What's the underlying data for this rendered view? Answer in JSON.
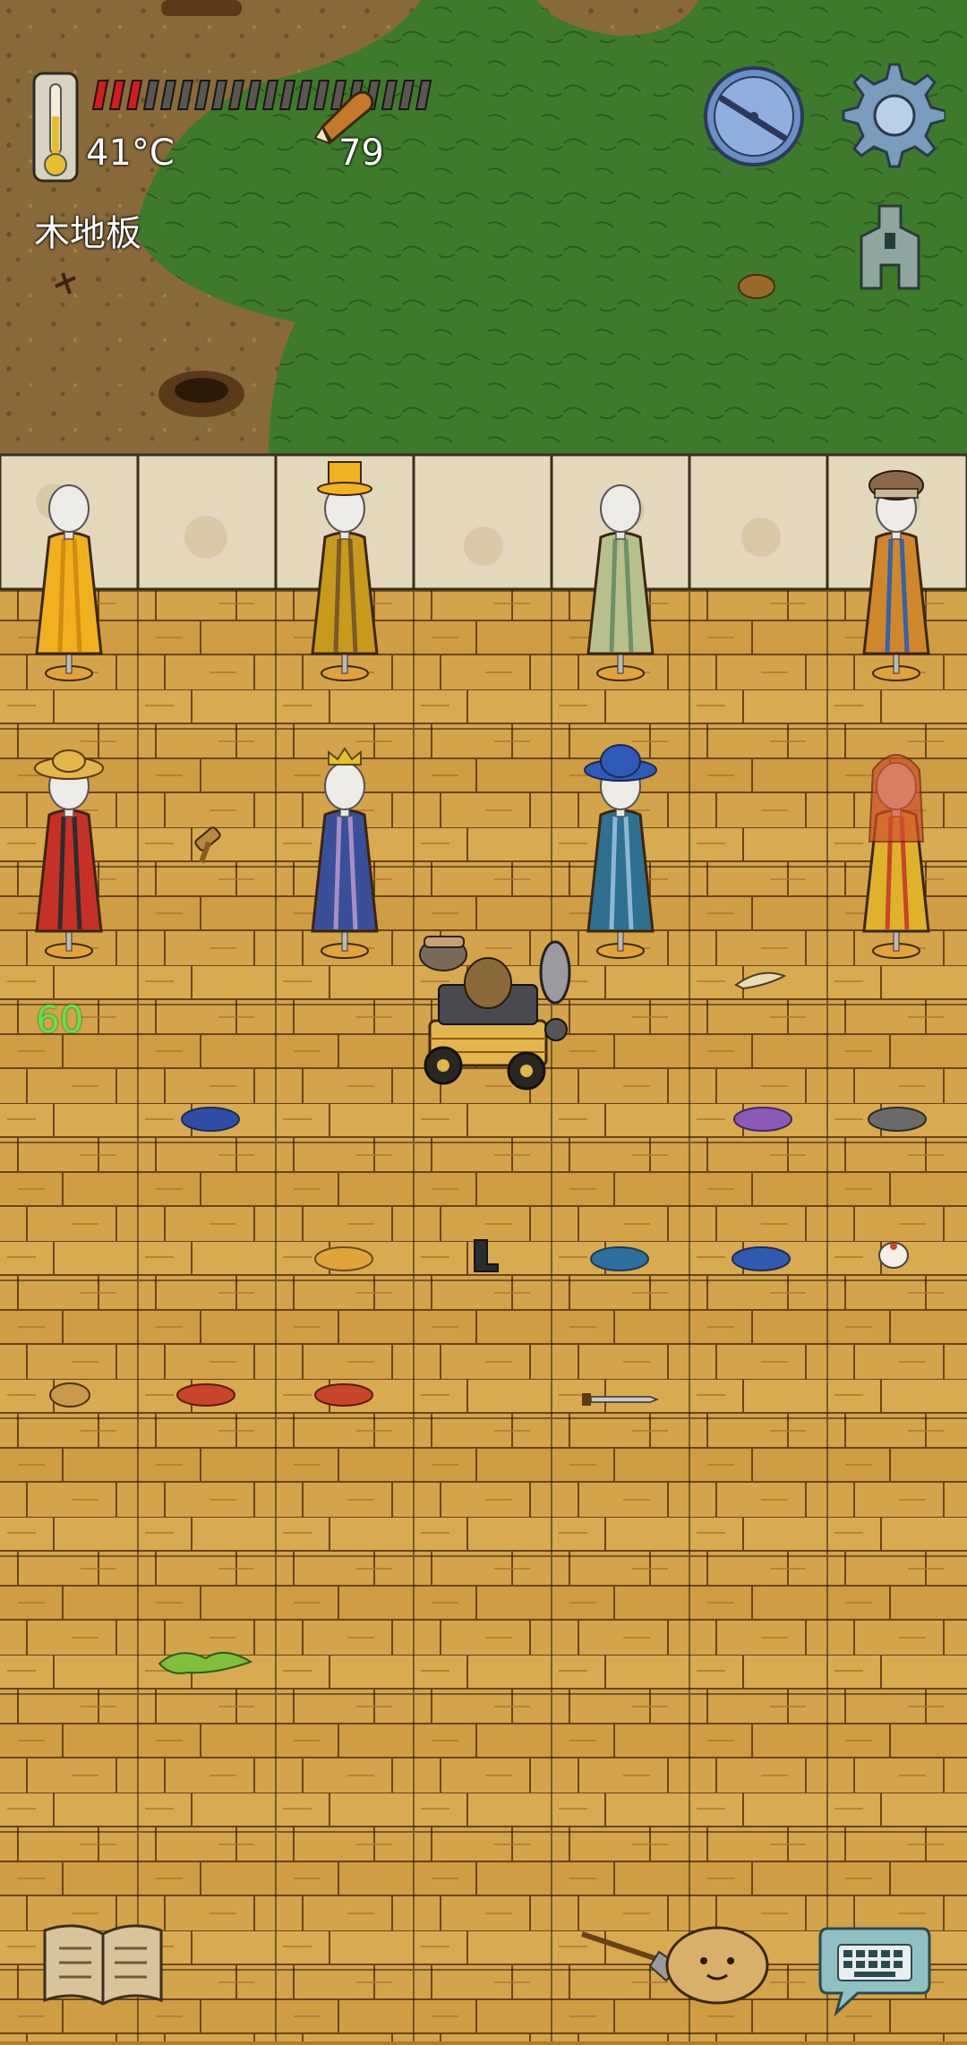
{
  "hud": {
    "temperature": "41°C",
    "food_count": "79",
    "floor_label": "木地板",
    "hunger_pips_filled": 3,
    "hunger_pips_total": 20
  },
  "world": {
    "overlay_number": "60"
  },
  "mannequins": [
    {
      "dress": "#f1b11e",
      "accent": "#d48a10",
      "hat": "none"
    },
    {
      "dress": "#c79a1c",
      "accent": "#7a5a2a",
      "hat": "top-hat"
    },
    {
      "dress": "#b7c08c",
      "accent": "#6f8f6a",
      "hat": "none"
    },
    {
      "dress": "#d0862a",
      "accent": "#3562a8",
      "hat": "fur-hat"
    },
    {
      "dress": "#c63028",
      "accent": "#2d2d2d",
      "hat": "straw-hat"
    },
    {
      "dress": "#3a4f9a",
      "accent": "#a78fc6",
      "hat": "crown"
    },
    {
      "dress": "#2f6f8f",
      "accent": "#8fb6d6",
      "hat": "blue-hat"
    },
    {
      "dress": "#e0b22c",
      "accent": "#c8442a",
      "hat": "veil"
    }
  ],
  "colors": {
    "wood_floor": "#d4a44a",
    "wood_line": "#6a4418",
    "grass": "#3e7a2c",
    "dirt": "#8a6a3a",
    "stone_wall": "#e4d8bc",
    "green_text": "#5fe34e",
    "hunger_red": "#d41c1c"
  },
  "icons": {
    "thermometer": "thermometer-icon",
    "compass": "compass-icon",
    "settings": "gear-icon",
    "fashion": "spade-coin-icon",
    "recipe_book": "book-icon",
    "emote": "potato-face-icon",
    "keyboard": "keyboard-chat-icon"
  }
}
